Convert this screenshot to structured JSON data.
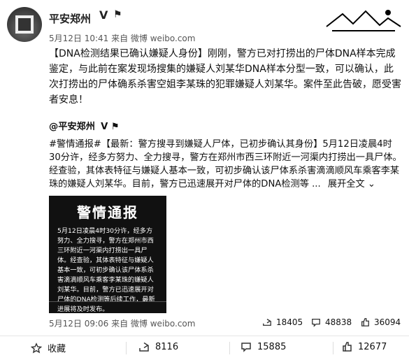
{
  "post": {
    "account_name": "平安郑州",
    "verified_v": "V",
    "meta": "5月12日 10:41 来自 微博 weibo.com",
    "text": "【DNA检测结果已确认嫌疑人身份】刚刚，警方已对打捞出的尸体DNA样本完成鉴定，与此前在案发现场搜集的嫌疑人刘某华DNA样本分型一致，可以确认，此次打捞出的尸体确系杀害空姐李某珠的犯罪嫌疑人刘某华。案件至此告破，愿受害者安息！"
  },
  "repost": {
    "user": "@平安郑州",
    "verified_v": "V",
    "text": "#警情通报#【最新：警方搜寻到嫌疑人尸体，已初步确认其身份】5月12日凌晨4时30分许，经多方努力、全力搜寻，警方在郑州市西三环附近一河渠内打捞出一具尸体。经查验，其体表特征与嫌疑人基本一致，可初步确认该尸体系杀害滴滴顺风车乘客李某珠的嫌疑人刘某华。目前，警方已迅速展开对尸体的DNA检测等 ...",
    "expand_label": "展开全文",
    "meta": "5月12日 09:06 来自 微博 weibo.com",
    "stats": {
      "reposts": "18405",
      "comments": "48838",
      "likes": "36094"
    }
  },
  "notice_image": {
    "title": "警情通报",
    "body": "5月12日凌晨4时30分许，经多方努力、全力搜寻，警方在郑州市西三环附近一河渠内打捞出一具尸体。经查验，其体表特征与嫌疑人基本一致，可初步确认该尸体系杀害滴滴顺风车乘客李某珠的嫌疑人刘某华。目前，警方已迅速展开对尸体的DNA检测等后续工作，最新进展将及时发布。"
  },
  "toolbar": {
    "favorite_label": "收藏",
    "repost_count": "8116",
    "comment_count": "15885",
    "like_count": "12677"
  },
  "colors": {
    "text": "#222",
    "meta": "#555",
    "divider": "#dddddd"
  }
}
